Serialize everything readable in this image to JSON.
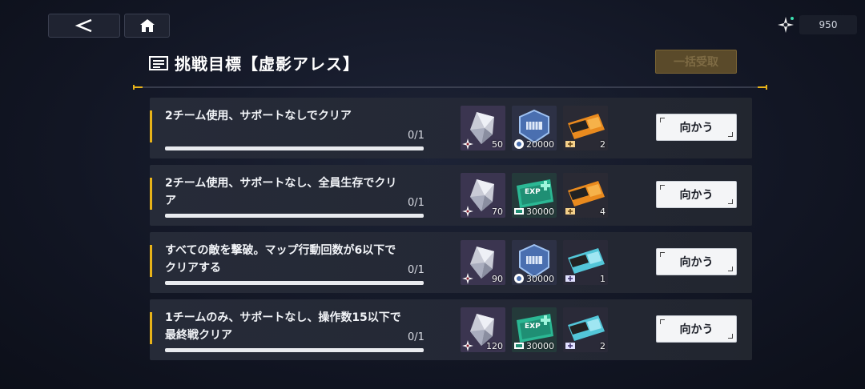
{
  "nav": {
    "back_icon": "back-arrow-icon",
    "home_icon": "home-icon"
  },
  "currency": {
    "icon": "shuriken-star-icon",
    "amount": "950"
  },
  "header": {
    "title": "挑戦目標【虚影アレス】",
    "icon": "list-icon",
    "claim_all_label": "一括受取"
  },
  "colors": {
    "accent": "#e8b319",
    "claim_disabled": "#5a4a2a"
  },
  "missions": [
    {
      "description": "2チーム使用、サポートなしでクリア",
      "progress": "0/1",
      "rewards": [
        {
          "icon": "crystal-shard-icon",
          "count": "50"
        },
        {
          "icon": "blue-coin-badge-icon",
          "count": "20000"
        },
        {
          "icon": "orange-ticket-icon",
          "count": "2"
        }
      ],
      "button_label": "向かう"
    },
    {
      "description": "2チーム使用、サポートなし、全員生存でクリア",
      "progress": "0/1",
      "rewards": [
        {
          "icon": "crystal-shard-icon",
          "count": "70"
        },
        {
          "icon": "exp-card-icon",
          "count": "30000"
        },
        {
          "icon": "orange-ticket-icon",
          "count": "4"
        }
      ],
      "button_label": "向かう"
    },
    {
      "description": "すべての敵を撃破。マップ行動回数が6以下でクリアする",
      "progress": "0/1",
      "rewards": [
        {
          "icon": "crystal-shard-icon",
          "count": "90"
        },
        {
          "icon": "blue-coin-badge-icon",
          "count": "30000"
        },
        {
          "icon": "cyan-ticket-icon",
          "count": "1"
        }
      ],
      "button_label": "向かう"
    },
    {
      "description": "1チームのみ、サポートなし、操作数15以下で最終戦クリア",
      "progress": "0/1",
      "rewards": [
        {
          "icon": "crystal-shard-icon",
          "count": "120"
        },
        {
          "icon": "exp-card-icon",
          "count": "30000"
        },
        {
          "icon": "cyan-ticket-icon",
          "count": "2"
        }
      ],
      "button_label": "向かう"
    }
  ]
}
